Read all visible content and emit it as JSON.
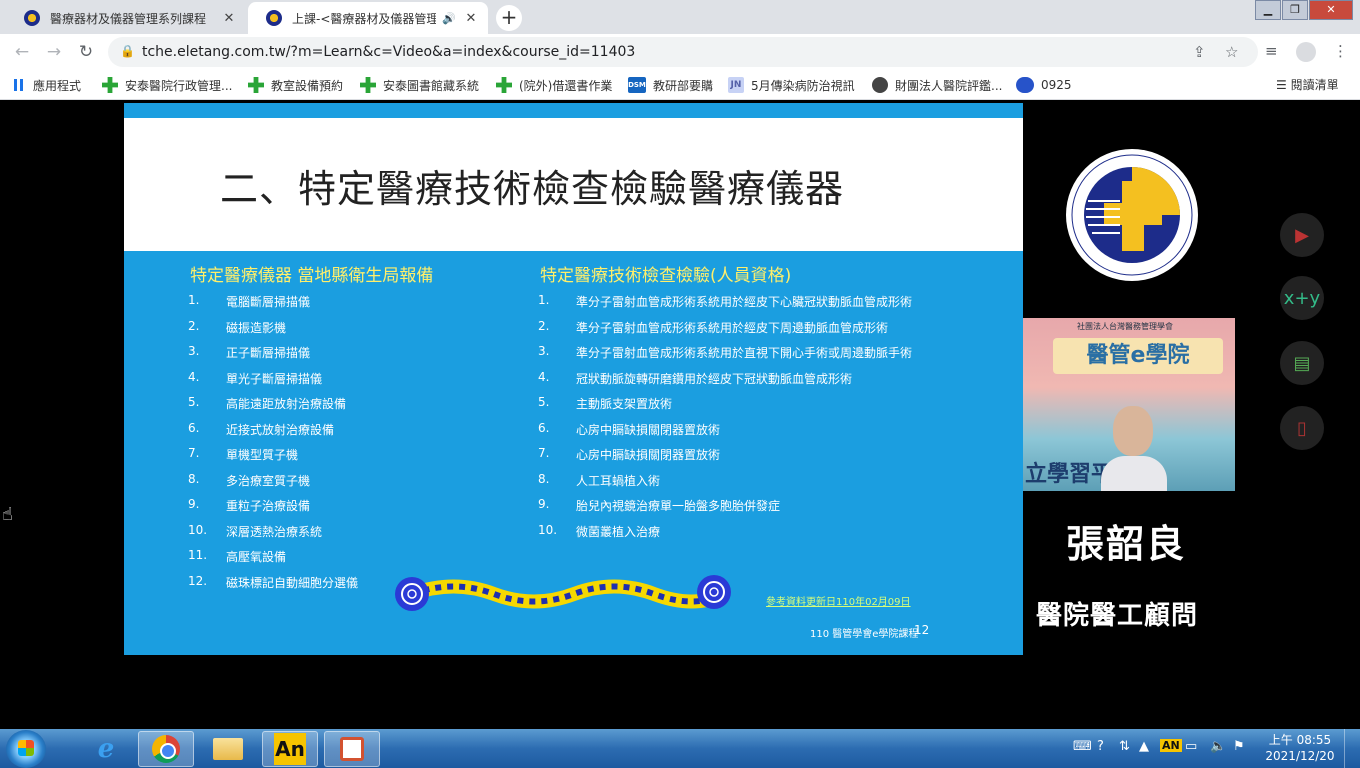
{
  "browser": {
    "tabs": [
      {
        "title": "醫療器材及儀器管理系列課程",
        "active": false
      },
      {
        "title": "上課-<醫療器材及儀器管理",
        "active": true
      }
    ],
    "url": "tche.eletang.com.tw/?m=Learn&c=Video&a=index&course_id=11403",
    "bookmarks": [
      {
        "label": "應用程式",
        "icon": "apps-grid-icon"
      },
      {
        "label": "安泰醫院行政管理...",
        "icon": "green-cross-icon"
      },
      {
        "label": "教室設備預約",
        "icon": "green-cross-icon"
      },
      {
        "label": "安泰圖書館藏系統",
        "icon": "green-cross-icon"
      },
      {
        "label": "(院外)借還書作業",
        "icon": "green-cross-icon"
      },
      {
        "label": "教研部要購",
        "icon": "dsm-icon",
        "badge": "DSM"
      },
      {
        "label": "5月傳染病防治視訊",
        "icon": "jn-icon",
        "badge": "JN"
      },
      {
        "label": "財團法人醫院評鑑...",
        "icon": "globe-icon"
      },
      {
        "label": "0925",
        "icon": "webex-icon"
      }
    ],
    "reading_list": "閱讀清單"
  },
  "slide": {
    "title": "二、特定醫療技術檢查檢驗醫療儀器",
    "left_heading": "特定醫療儀器 當地縣衛生局報備",
    "left_items": [
      {
        "num": "1.",
        "text": "電腦斷層掃描儀"
      },
      {
        "num": "2.",
        "text": "磁振造影機"
      },
      {
        "num": "3.",
        "text": "正子斷層掃描儀"
      },
      {
        "num": "4.",
        "text": "單光子斷層掃描儀"
      },
      {
        "num": "5.",
        "text": "高能遠距放射治療設備"
      },
      {
        "num": "6.",
        "text": "近接式放射治療設備"
      },
      {
        "num": "7.",
        "text": "單機型質子機"
      },
      {
        "num": "8.",
        "text": "多治療室質子機"
      },
      {
        "num": "9.",
        "text": "重粒子治療設備"
      },
      {
        "num": "10.",
        "text": "深層透熱治療系統"
      },
      {
        "num": "11.",
        "text": "高壓氧設備"
      },
      {
        "num": "12.",
        "text": "磁珠標記自動細胞分選儀"
      }
    ],
    "right_heading": "特定醫療技術檢查檢驗(人員資格)",
    "right_items": [
      {
        "num": "1.",
        "text": "準分子雷射血管成形術系統用於經皮下心臟冠狀動脈血管成形術"
      },
      {
        "num": "2.",
        "text": "準分子雷射血管成形術系統用於經皮下周邊動脈血管成形術"
      },
      {
        "num": "3.",
        "text": "準分子雷射血管成形術系統用於直視下開心手術或周邊動脈手術"
      },
      {
        "num": "4.",
        "text": "冠狀動脈旋轉研磨鑽用於經皮下冠狀動脈血管成形術"
      },
      {
        "num": "5.",
        "text": "主動脈支架置放術"
      },
      {
        "num": "6.",
        "text": "心房中膈缺損關閉器置放術"
      },
      {
        "num": "7.",
        "text": "心房中膈缺損關閉器置放術"
      },
      {
        "num": "8.",
        "text": "人工耳蝸植入術"
      },
      {
        "num": "9.",
        "text": "胎兒內視鏡治療單一胎盤多胞胎併發症"
      },
      {
        "num": "10.",
        "text": "微菌叢植入治療"
      }
    ],
    "note": "參考資料更新日110年02月09日",
    "footer": "110 醫管學會e學院課程",
    "page_number": "12"
  },
  "webcam": {
    "banner": "醫管e學院",
    "top_text": "社團法人台灣醫務管理學會",
    "bottom_text": "立學習平"
  },
  "speaker": {
    "name": "張韶良",
    "title": "醫院醫工顧問"
  },
  "taskbar": {
    "clock_time": "上午 08:55",
    "clock_date": "2021/12/20",
    "tray_an": "AN"
  },
  "colors": {
    "slide_blue": "#1b9ee0",
    "heading_yellow": "#ffef6b",
    "taskbar_blue": "#2c6cb1"
  }
}
